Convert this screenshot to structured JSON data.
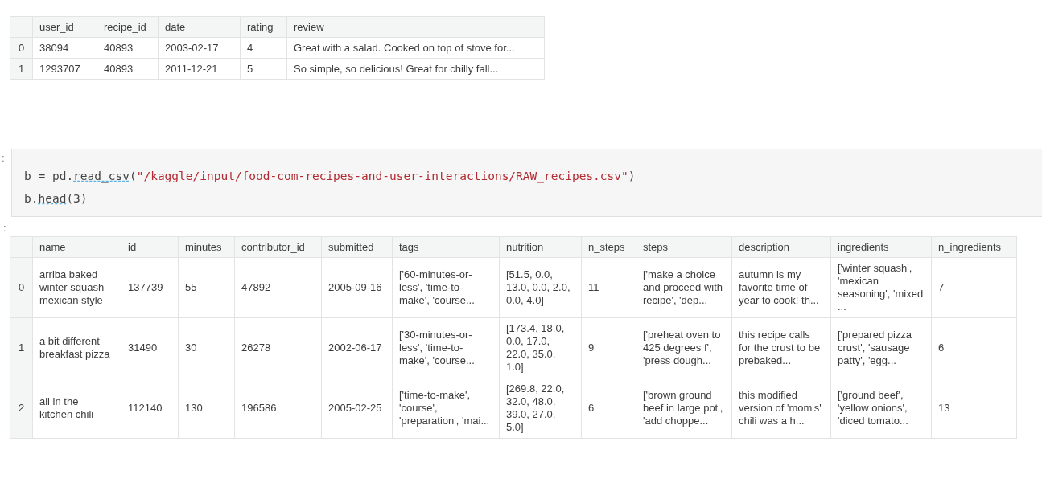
{
  "output_1": {
    "table": {
      "columns": [
        "",
        "user_id",
        "recipe_id",
        "date",
        "rating",
        "review"
      ],
      "rows": [
        [
          "0",
          "38094",
          "40893",
          "2003-02-17",
          "4",
          "Great with a salad. Cooked on top of stove for..."
        ],
        [
          "1",
          "1293707",
          "40893",
          "2011-12-21",
          "5",
          "So simple, so delicious! Great for chilly fall..."
        ]
      ]
    }
  },
  "code_cell": {
    "prompt": ":",
    "lines": [
      [
        {
          "kind": "plain",
          "text": "b = pd."
        },
        {
          "kind": "warn",
          "text": "read_csv"
        },
        {
          "kind": "plain",
          "text": "("
        },
        {
          "kind": "string",
          "text": "\"/kaggle/input/food-com-recipes-and-user-interactions/RAW_recipes.csv\""
        },
        {
          "kind": "plain",
          "text": ")"
        }
      ],
      [
        {
          "kind": "plain",
          "text": "b."
        },
        {
          "kind": "warn",
          "text": "head"
        },
        {
          "kind": "plain",
          "text": "(3)"
        }
      ]
    ]
  },
  "output_2": {
    "prompt": ":",
    "table": {
      "columns": [
        "",
        "name",
        "id",
        "minutes",
        "contributor_id",
        "submitted",
        "tags",
        "nutrition",
        "n_steps",
        "steps",
        "description",
        "ingredients",
        "n_ingredients"
      ],
      "rows": [
        [
          "0",
          "arriba baked winter squash mexican style",
          "137739",
          "55",
          "47892",
          "2005-09-16",
          "['60-minutes-or-less', 'time-to-make', 'course...",
          "[51.5, 0.0, 13.0, 0.0, 2.0, 0.0, 4.0]",
          "11",
          "['make a choice and proceed with recipe', 'dep...",
          "autumn is my favorite time of year to cook! th...",
          "['winter squash', 'mexican seasoning', 'mixed ...",
          "7"
        ],
        [
          "1",
          "a bit different breakfast pizza",
          "31490",
          "30",
          "26278",
          "2002-06-17",
          "['30-minutes-or-less', 'time-to-make', 'course...",
          "[173.4, 18.0, 0.0, 17.0, 22.0, 35.0, 1.0]",
          "9",
          "['preheat oven to 425 degrees f', 'press dough...",
          "this recipe calls for the crust to be prebaked...",
          "['prepared pizza crust', 'sausage patty', 'egg...",
          "6"
        ],
        [
          "2",
          "all in the kitchen chili",
          "112140",
          "130",
          "196586",
          "2005-02-25",
          "['time-to-make', 'course', 'preparation', 'mai...",
          "[269.8, 22.0, 32.0, 48.0, 39.0, 27.0, 5.0]",
          "6",
          "['brown ground beef in large pot', 'add choppe...",
          "this modified version of 'mom's' chili was a h...",
          "['ground beef', 'yellow onions', 'diced tomato...",
          "13"
        ]
      ]
    }
  }
}
